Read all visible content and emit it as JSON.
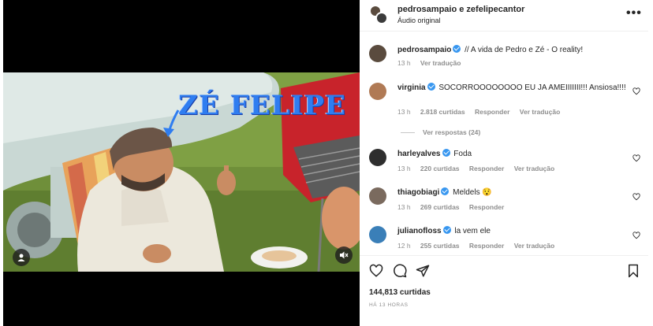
{
  "post": {
    "authors": "pedrosampaio e zefelipecantor",
    "audio": "Áudio original",
    "overlay_text": "ZÉ FELIPE"
  },
  "comments": [
    {
      "user": "pedrosampaio",
      "verified": true,
      "text": "// A vida de Pedro e Zé - O reality!",
      "time": "13 h",
      "likes": "",
      "reply": "",
      "translate": "Ver tradução",
      "avatar_color": "#5a4b3e"
    },
    {
      "user": "virginia",
      "verified": true,
      "text": "SOCORROOOOOOOO EU JA AMEIIIIIII!!! Ansiosa!!!!",
      "time": "13 h",
      "likes": "2.818 curtidas",
      "reply": "Responder",
      "translate": "Ver tradução",
      "replies": "Ver respostas (24)",
      "avatar_color": "#b07a55"
    },
    {
      "user": "harleyalves",
      "verified": true,
      "text": "Foda",
      "time": "13 h",
      "likes": "220 curtidas",
      "reply": "Responder",
      "translate": "Ver tradução",
      "avatar_color": "#2e2e2e"
    },
    {
      "user": "thiagobiagi",
      "verified": true,
      "text": "Meldels 😯",
      "time": "13 h",
      "likes": "269 curtidas",
      "reply": "Responder",
      "translate": "",
      "avatar_color": "#7a6a5e"
    },
    {
      "user": "julianofloss",
      "verified": true,
      "text": "la vem ele",
      "time": "12 h",
      "likes": "255 curtidas",
      "reply": "Responder",
      "translate": "Ver tradução",
      "avatar_color": "#3a7fb8"
    }
  ],
  "footer": {
    "likes": "144,813 curtidas",
    "time": "HÁ 13 HORAS"
  },
  "icons": {
    "more": "more-icon",
    "heart": "heart-icon",
    "comment": "comment-icon",
    "share": "share-icon",
    "save": "bookmark-icon",
    "user_tag": "user-icon",
    "mute": "mute-icon"
  },
  "colors": {
    "verified": "#3897f0",
    "secondary_text": "#8e8e8e",
    "overlay_text": "#2f7df0"
  }
}
